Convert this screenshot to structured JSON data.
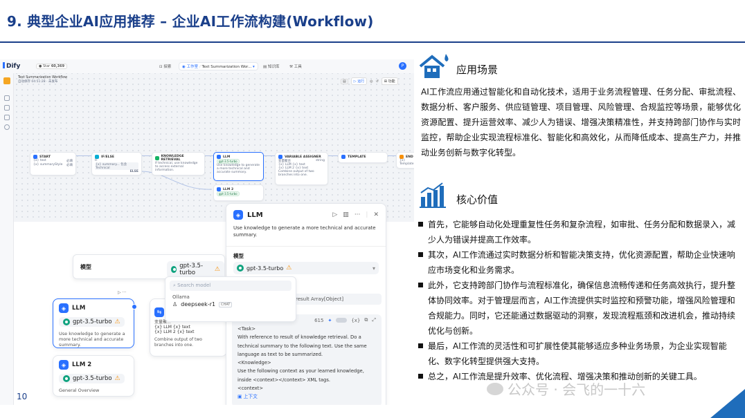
{
  "slide": {
    "title": "9. 典型企业AI应用推荐 – 企业AI工作流构建(Workflow)",
    "page_number": "10"
  },
  "dify": {
    "brand": "Dify",
    "star_label": "Star",
    "star_count": "60,369",
    "nav": [
      "探索",
      "工作室",
      "Text Summarization Wor...",
      "知识库",
      "工具"
    ],
    "user_initial": "P",
    "app_name": "Text Summarization Workflow",
    "autosave": "自动保存 04:51:28 · 未发布",
    "run_label": "运行",
    "features_label": "功能",
    "nodes": {
      "start": {
        "title": "START",
        "fields": [
          {
            "name": "{x} text",
            "req": "必填"
          },
          {
            "name": "{x} summaryStyle",
            "req": "必填"
          }
        ]
      },
      "ifelse": {
        "title": "IF/ELSE",
        "if": "IF",
        "cond": "{x} summary... 包含 Technical",
        "else": "ELSE"
      },
      "knowledge": {
        "title": "KNOWLEDGE RETRIEVAL",
        "desc": "If technical, use knowledge to access external information."
      },
      "llm_small": {
        "title": "LLM",
        "model": "gpt-3.5-turbo",
        "desc": "Use knowledge to generate a more technical and accurate summary."
      },
      "llm2_small": {
        "title": "LLM 2",
        "model": "gpt-3.5-turbo"
      },
      "var_assigner": {
        "title": "VARIABLE ASSIGNER",
        "label": "变量聚合",
        "type": "string",
        "items": [
          "{x} LLM  {x} text",
          "{x} LLM 2  {x} text"
        ],
        "desc": "Combine output of two branches into one."
      },
      "template": {
        "title": "TEMPLATE"
      },
      "end": {
        "title": "END",
        "out": "{x} Template"
      }
    },
    "panel": {
      "title": "LLM",
      "desc": "Use knowledge to generate a more technical and accurate summary.",
      "model_label": "模型",
      "model": "gpt-3.5-turbo",
      "context_var": "result Array[Object]",
      "prompt_count": "615",
      "prompt_lines": [
        "<Task>",
        "With reference to result of knowledge retrieval. Do a",
        "technical summary to the following text. Use the same",
        "language as text to be summarized.",
        "<Knowledge>",
        "Use the following context as your learned knowledge,",
        "inside <context></context> XML tags.",
        "<context>",
        "上下文"
      ]
    },
    "model_card": {
      "label": "模型",
      "model": "gpt-3.5-turbo"
    },
    "dropdown": {
      "search_placeholder": "Search model",
      "group": "Ollama",
      "option": "deepseek-r1",
      "option_tag": "CHAT"
    },
    "llm_card": {
      "title": "LLM",
      "model": "gpt-3.5-turbo",
      "desc": "Use knowledge to generate a more technical and accurate summary."
    },
    "llm2_card": {
      "title": "LLM 2",
      "model": "gpt-3.5-turbo",
      "desc": "General Overview"
    },
    "va_card": {
      "label": "变量聚...",
      "items": [
        "{x} LLM  {x} text",
        "{x} LLM 2  {x} text"
      ],
      "desc": "Combine output of two branches into one."
    }
  },
  "scenario": {
    "title": "应用场景",
    "text": "AI工作流应用通过智能化和自动化技术，适用于业务流程管理、任务分配、审批流程、数据分析、客户服务、供应链管理、项目管理、风险管理、合规监控等场景，能够优化资源配置、提升运营效率、减少人为错误、增强决策精准性，并支持跨部门协作与实时监控，帮助企业实现流程标准化、智能化和高效化，从而降低成本、提高生产力，并推动业务创新与数字化转型。"
  },
  "value": {
    "title": "核心价值",
    "bullets": [
      "首先，它能够自动化处理重复性任务和复杂流程，如审批、任务分配和数据录入，减少人为错误并提高工作效率。",
      "其次，AI工作流通过实时数据分析和智能决策支持，优化资源配置，帮助企业快速响应市场变化和业务需求。",
      "此外，它支持跨部门协作与流程标准化，确保信息流畅传递和任务高效执行，提升整体协同效率。对于管理层而言，AI工作流提供实时监控和预警功能，增强风险管理和合规能力。同时，它还能通过数据驱动的洞察，发现流程瓶颈和改进机会，推动持续优化与创新。",
      "最后，AI工作流的灵活性和可扩展性使其能够适应多种业务场景，为企业实现智能化、数字化转型提供强大支持。",
      "总之，AI工作流是提升效率、优化流程、增强决策和推动创新的关键工具。"
    ]
  },
  "watermark": "公众号 · 会飞的一十六",
  "colors": {
    "title": "#1a3f8a",
    "accent": "#1f6dbb",
    "dify_blue": "#2970ff",
    "model_green": "#10a37f"
  }
}
